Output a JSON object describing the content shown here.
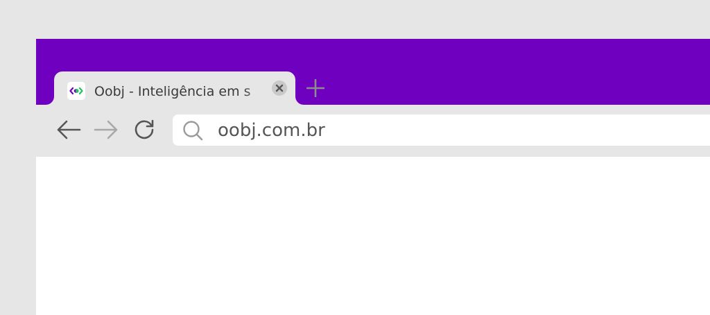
{
  "colors": {
    "tab_strip": "#6f00c0",
    "background": "#e6e6e6",
    "favicon_left": "#6f00c0",
    "favicon_right": "#22c55e"
  },
  "tab": {
    "title": "Oobj - Inteligência em s",
    "favicon_icon": "oobj-logo-icon",
    "close_icon": "close-icon"
  },
  "new_tab": {
    "icon": "plus-icon"
  },
  "toolbar": {
    "back_icon": "arrow-left-icon",
    "forward_icon": "arrow-right-icon",
    "reload_icon": "reload-icon"
  },
  "address_bar": {
    "icon": "search-icon",
    "url": "oobj.com.br"
  }
}
